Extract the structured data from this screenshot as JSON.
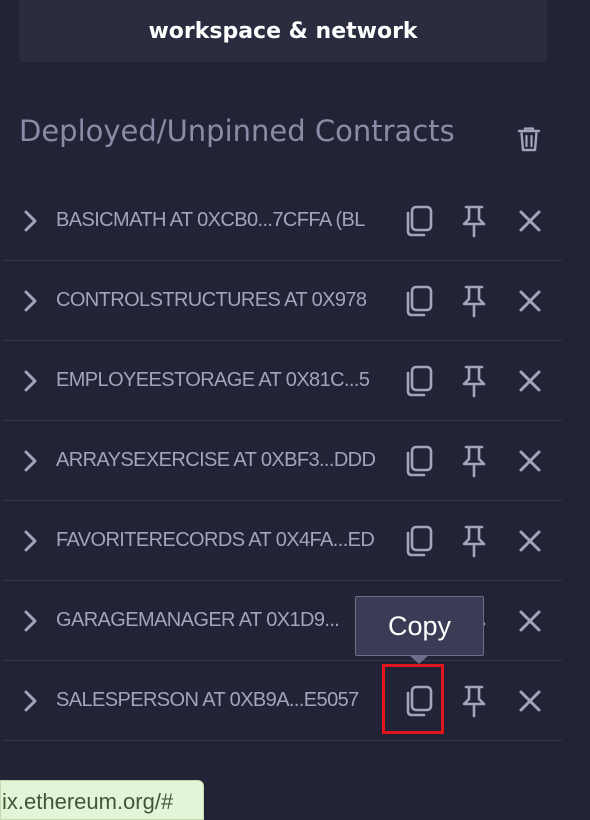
{
  "banner": {
    "text": "workspace & network"
  },
  "section": {
    "title": "Deployed/Unpinned Contracts",
    "clear_icon": "trash-icon"
  },
  "contracts": [
    {
      "label": "BASICMATH AT 0XCB0...7CFFA (BL",
      "expanded": false
    },
    {
      "label": "CONTROLSTRUCTURES AT 0X978",
      "expanded": false
    },
    {
      "label": "EMPLOYEESTORAGE AT 0X81C...5",
      "expanded": false
    },
    {
      "label": "ARRAYSEXERCISE AT 0XBF3...DDD",
      "expanded": false
    },
    {
      "label": "FAVORITERECORDS AT 0X4FA...ED",
      "expanded": false
    },
    {
      "label": "GARAGEMANAGER AT 0X1D9...",
      "expanded": false
    },
    {
      "label": "SALESPERSON AT 0XB9A...E5057",
      "expanded": false
    }
  ],
  "row_icons": {
    "expand": "chevron-right-icon",
    "copy": "copy-icon",
    "pin": "pin-icon",
    "remove": "close-icon"
  },
  "tooltip": {
    "text": "Copy"
  },
  "status_bar": {
    "url": "ix.ethereum.org/#"
  },
  "colors": {
    "background": "#222336",
    "panel": "#2a2c3f",
    "text": "#a2a3bd",
    "highlight": "#e3161d",
    "status_bg": "#e3f4d7"
  }
}
